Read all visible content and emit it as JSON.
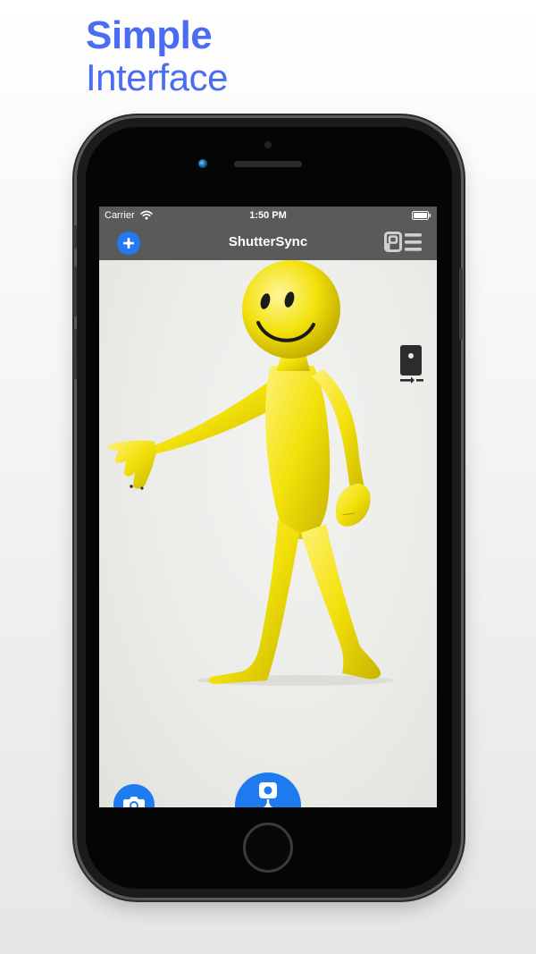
{
  "promo": {
    "title_line1": "Simple",
    "title_line2": "Interface"
  },
  "status_bar": {
    "carrier": "Carrier",
    "time": "1:50 PM",
    "icons": [
      "wifi-icon",
      "battery-icon"
    ]
  },
  "nav": {
    "title": "ShutterSync",
    "left_button_icon": "plus-icon",
    "right_button_icon": "pe-menu-icon"
  },
  "controls": {
    "device_switch_icon": "device-switch-icon",
    "camera_icon": "camera-icon",
    "sync_icon": "multi-camera-sync-icon"
  },
  "colors": {
    "accent": "#1e7cf0",
    "promo_text": "#4a6cf2",
    "bar": "#5a5a5a",
    "figure": "#f2e10a"
  }
}
